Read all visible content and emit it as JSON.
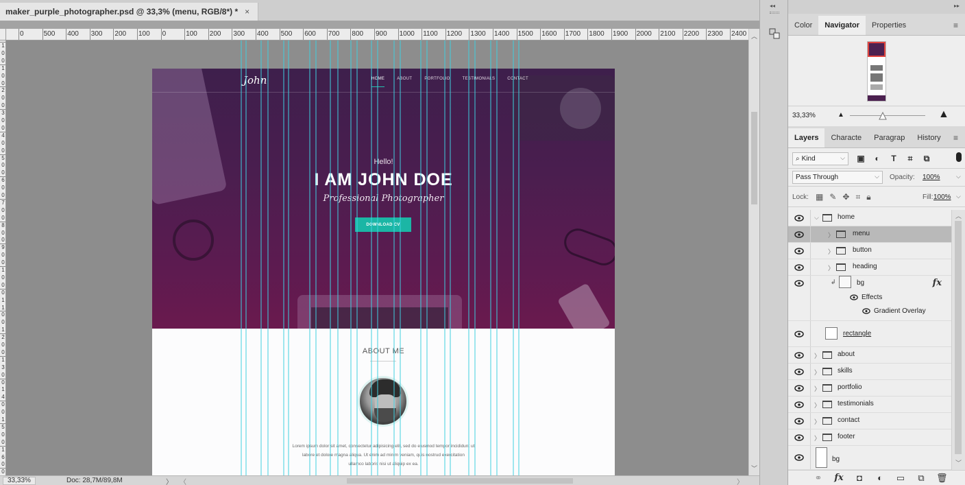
{
  "document": {
    "tab_title": "maker_purple_photographer.psd @ 33,3% (menu, RGB/8*) *",
    "close_glyph": "×"
  },
  "ruler": {
    "h_ticks": [
      "0",
      "500",
      "400",
      "300",
      "200",
      "100",
      "0",
      "100",
      "200",
      "300",
      "400",
      "500",
      "600",
      "700",
      "800",
      "900",
      "1000",
      "1100",
      "1200",
      "1300",
      "1400",
      "1500",
      "1600",
      "1700",
      "1800",
      "1900",
      "2000",
      "2100",
      "2200",
      "2300",
      "2400"
    ],
    "v_ticks": [
      "1",
      "0",
      "0",
      "1",
      "0",
      "0",
      "2",
      "0",
      "0",
      "3",
      "0",
      "0",
      "4",
      "0",
      "0",
      "5",
      "0",
      "0",
      "6",
      "0",
      "0",
      "7",
      "0",
      "0",
      "8",
      "0",
      "0",
      "9",
      "0",
      "0",
      "1",
      "0",
      "0",
      "0",
      "1",
      "1",
      "0",
      "0",
      "1",
      "2",
      "0",
      "0",
      "1",
      "3",
      "0",
      "0",
      "1",
      "4",
      "0",
      "0",
      "1",
      "5",
      "0",
      "0",
      "1",
      "6",
      "0",
      "0"
    ]
  },
  "site": {
    "logo": "John",
    "nav": [
      "HOME",
      "ABOUT",
      "PORTFOLIO",
      "TESTIMONIALS",
      "CONTACT"
    ],
    "hello": "Hello!",
    "headline": "I AM JOHN DOE",
    "subline": "Professional Photographer",
    "cv_button": "DOWNLOAD CV",
    "about_title": "ABOUT ME",
    "lorem_lines": [
      "Lorem ipsum dolor sit amet, consectetur adipisicing elit, sed do eiusmod tempor incididunt ut",
      "labore et dolore magna aliqua. Ut enim ad minim veniam, quis nostrud exercitation",
      "ullamco laboris nisi ut aliquip ex ea."
    ],
    "accent_color": "#1bb6a5",
    "guide_color": "#3fd0e0"
  },
  "status": {
    "zoom": "33,33%",
    "doc": "Doc: 28,7M/89,8M",
    "arrow": "〉",
    "left_arrow": "〈",
    "right_arrow": "〉"
  },
  "navigator": {
    "tabs": [
      "Color",
      "Navigator",
      "Properties"
    ],
    "active_tab": "Navigator",
    "zoom_value": "33,33%"
  },
  "layers": {
    "tabs": [
      "Layers",
      "Characte",
      "Paragrap",
      "History"
    ],
    "active_tab": "Layers",
    "kind_label": "Kind",
    "filter_text_icon": "T",
    "blend_mode": "Pass Through",
    "opacity_label": "Opacity:",
    "opacity_value": "100%",
    "lock_label": "Lock:",
    "fill_label": "Fill:",
    "fill_value": "100%",
    "rows": [
      {
        "name": "home",
        "type": "group",
        "expanded": true
      },
      {
        "name": "menu",
        "type": "group",
        "selected": true
      },
      {
        "name": "button",
        "type": "group"
      },
      {
        "name": "heading",
        "type": "group"
      },
      {
        "name": "bg",
        "type": "smart-object",
        "fx": "fx"
      },
      {
        "name": "Effects",
        "type": "effects"
      },
      {
        "name": "Gradient Overlay",
        "type": "effect"
      },
      {
        "name": "rectangle",
        "type": "shape"
      },
      {
        "name": "about",
        "type": "group"
      },
      {
        "name": "skills",
        "type": "group"
      },
      {
        "name": "portfolio",
        "type": "group"
      },
      {
        "name": "testimonials",
        "type": "group"
      },
      {
        "name": "contact",
        "type": "group"
      },
      {
        "name": "footer",
        "type": "group"
      },
      {
        "name": "bg",
        "type": "layer"
      }
    ],
    "footer_fx": "fx"
  }
}
